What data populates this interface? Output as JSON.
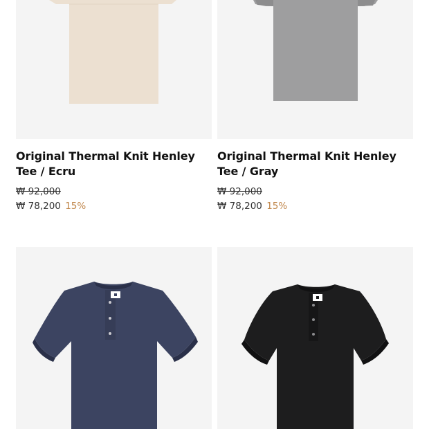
{
  "products": [
    {
      "title": "Original Thermal Knit Henley Tee / Ecru",
      "original_price": "₩ 92,000",
      "sale_price": "₩ 78,200",
      "discount": "15%",
      "color": "#ece0d1"
    },
    {
      "title": "Original Thermal Knit Henley Tee / Gray",
      "original_price": "₩ 92,000",
      "sale_price": "₩ 78,200",
      "discount": "15%",
      "color": "#9d9d9f"
    },
    {
      "color": "#3c4461"
    },
    {
      "color": "#1d1d1e"
    }
  ],
  "colors": {
    "discount": "#c0864a",
    "image_background": "#f4f4f4"
  }
}
